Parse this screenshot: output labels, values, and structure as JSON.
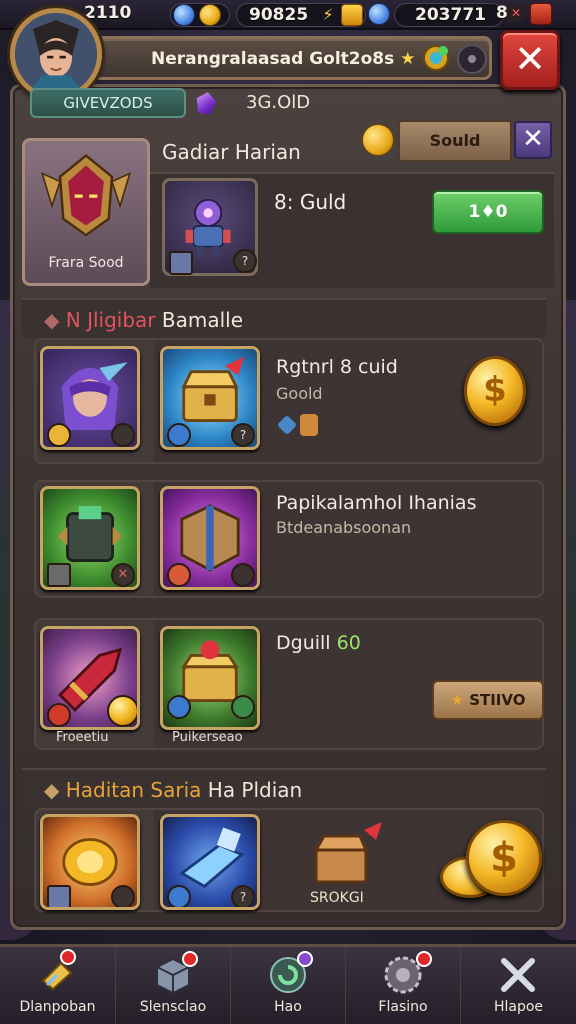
{
  "top_bar": {
    "player_level": "2110",
    "blue_currency": "90825",
    "gold_currency": "203771",
    "energy": "8"
  },
  "header": {
    "title": "Nerangralaasad Golt2o8s",
    "star_glyph": "★",
    "close_glyph": "✕"
  },
  "sub_header": {
    "tab_label": "GIVEVZODS",
    "gold_label": "3G.OlD"
  },
  "featured": {
    "title": "Gadiar Harian",
    "portrait_label": "Frara Sood",
    "price": "8: Guld",
    "buy_button": "1♦0",
    "sold_button": "Sould",
    "dismiss_button": "✕"
  },
  "section_one": {
    "title_red": "N Jligibar",
    "title_rest": " Bamalle",
    "rows": [
      {
        "title": "Rgtnrl 8 cuid",
        "subtitle": "Goold"
      },
      {
        "title": "Papikalamhol Ihanias",
        "subtitle": "Btdeanabsoonan"
      },
      {
        "title": "Dguill",
        "title_green": "60",
        "slot1_caption": "Froeetiu",
        "slot2_caption": "Puikerseao",
        "store_button": "STIIVO"
      }
    ]
  },
  "section_two": {
    "title_orange": "Haditan Saria",
    "title_rest": "Ha Pldian",
    "chest_caption": "SROKGI"
  },
  "bottom_nav": [
    {
      "label": "Dlanpoban",
      "icon": "diamond-shield-icon"
    },
    {
      "label": "Slensclao",
      "icon": "cube-icon"
    },
    {
      "label": "Hao",
      "icon": "refresh-orb-icon"
    },
    {
      "label": "Flasino",
      "icon": "gear-orb-icon"
    },
    {
      "label": "Hlapoe",
      "icon": "crossed-swords-icon"
    }
  ],
  "colors": {
    "panel": "#3e3634",
    "accent_gold": "#f4b826",
    "close_red": "#c4302b",
    "buy_green": "#2f9a38",
    "text_red": "#e0545d",
    "text_orange": "#e8a23a",
    "text_green": "#9be36a"
  }
}
